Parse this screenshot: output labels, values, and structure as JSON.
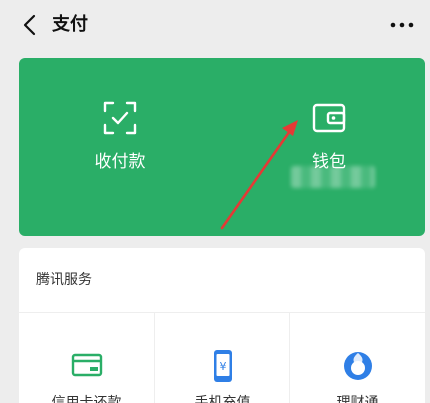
{
  "header": {
    "title": "支付",
    "back_icon": "chevron-left-icon",
    "more_icon": "more-horizontal-icon"
  },
  "card": {
    "color": "#2aae67",
    "actions": [
      {
        "label": "收付款",
        "icon": "scan-qr-icon"
      },
      {
        "label": "钱包",
        "icon": "wallet-icon"
      }
    ]
  },
  "annotation": {
    "arrow_color": "#e53935"
  },
  "services": {
    "title": "腾讯服务",
    "items": [
      {
        "label": "信用卡还款",
        "icon": "credit-card-repay-icon",
        "color": "#2aae67"
      },
      {
        "label": "手机充值",
        "icon": "phone-recharge-icon",
        "color": "#2f7fe6"
      },
      {
        "label": "理财通",
        "icon": "wealth-icon",
        "color": "#2f7fe6"
      }
    ]
  }
}
